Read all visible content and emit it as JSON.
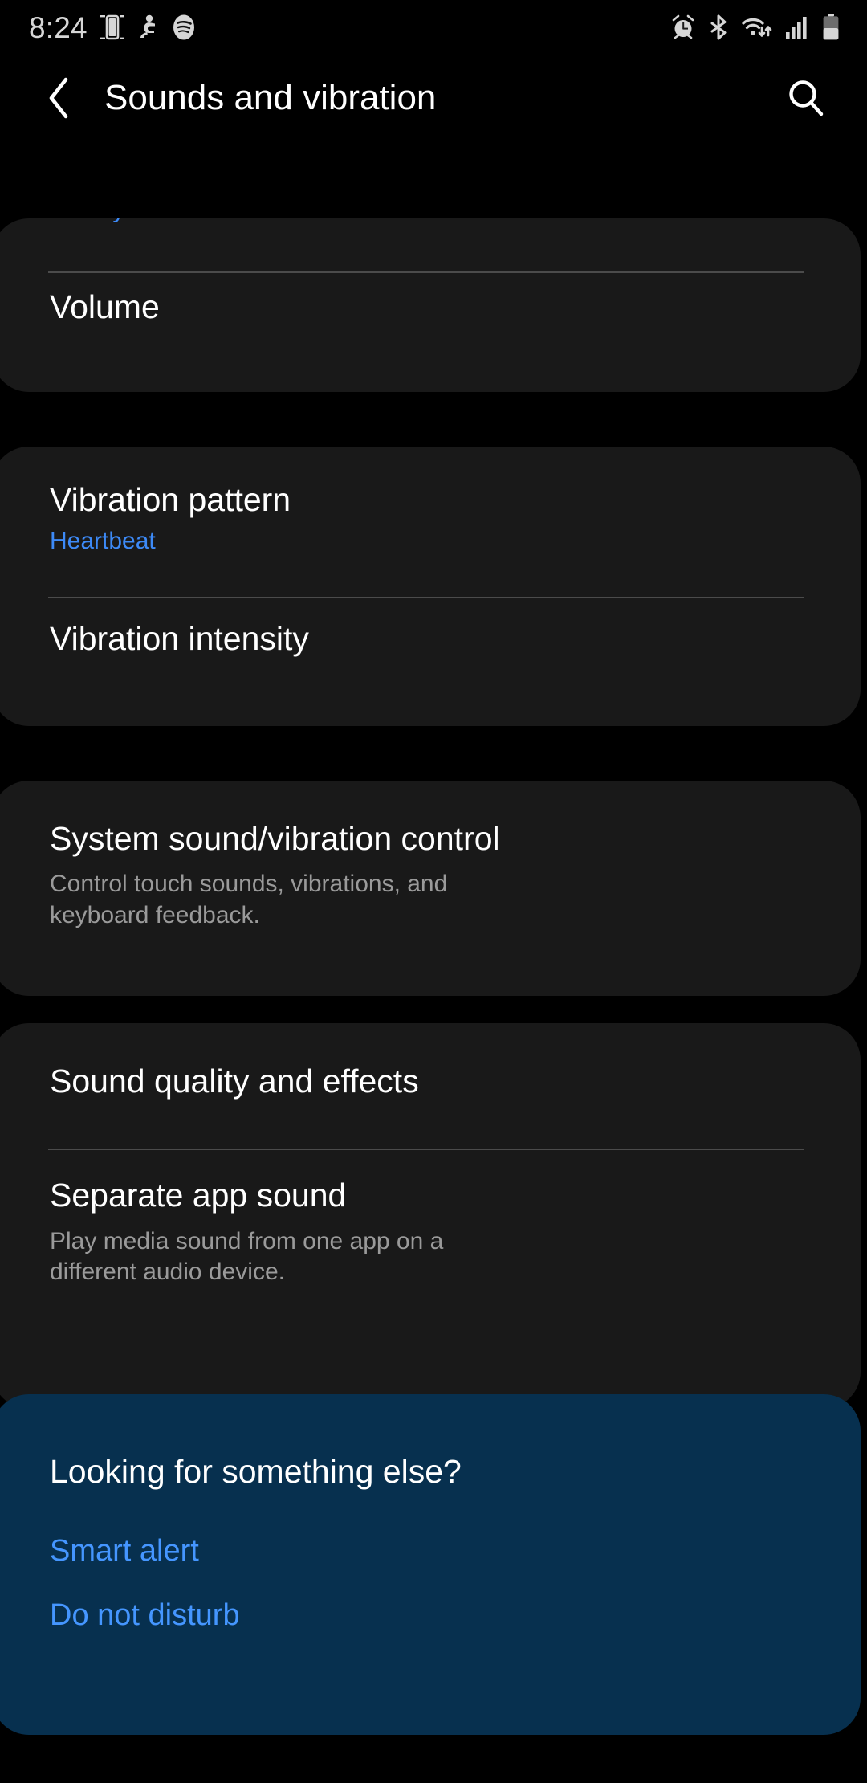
{
  "status_bar": {
    "time": "8:24",
    "left_icons": [
      "smart-view-icon",
      "accessibility-icon",
      "spotify-icon"
    ],
    "right_icons": [
      "alarm-icon",
      "bluetooth-icon",
      "wifi-icon",
      "signal-icon",
      "battery-icon"
    ]
  },
  "header": {
    "back_icon": "back-chevron-icon",
    "title": "Sounds and vibration",
    "search_icon": "search-icon"
  },
  "colors": {
    "background": "#000000",
    "card": "#191919",
    "card_highlight": "#07304f",
    "accent_blue": "#3d8af7",
    "link_blue": "#4596ff",
    "secondary_text": "#9a9a9a",
    "divider": "#4b4b4b"
  },
  "scrolled_off_item": {
    "subtitle": "Galaxy"
  },
  "cards": [
    {
      "name": "ringtone-volume-card",
      "rows": [
        {
          "title": "Volume"
        }
      ]
    },
    {
      "name": "vibration-card",
      "rows": [
        {
          "title": "Vibration pattern",
          "subtitle_blue": "Heartbeat"
        },
        {
          "title": "Vibration intensity"
        }
      ]
    },
    {
      "name": "system-sound-card",
      "rows": [
        {
          "title": "System sound/vibration control",
          "subtitle_gray": "Control touch sounds, vibrations, and keyboard feedback."
        }
      ]
    },
    {
      "name": "sound-quality-card",
      "rows": [
        {
          "title": "Sound quality and effects"
        },
        {
          "title": "Separate app sound",
          "subtitle_gray": "Play media sound from one app on a different audio device."
        }
      ]
    }
  ],
  "looking_for": {
    "heading": "Looking for something else?",
    "links": [
      {
        "label": "Smart alert"
      },
      {
        "label": "Do not disturb"
      }
    ]
  }
}
